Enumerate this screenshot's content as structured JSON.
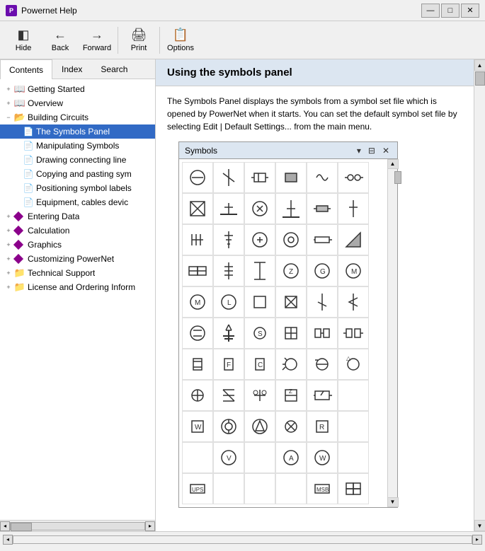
{
  "app": {
    "title": "Powernet Help",
    "icon": "P"
  },
  "title_controls": {
    "minimize": "—",
    "maximize": "□",
    "close": "✕"
  },
  "toolbar": {
    "buttons": [
      {
        "id": "hide",
        "label": "Hide",
        "icon": "◧"
      },
      {
        "id": "back",
        "label": "Back",
        "icon": "←"
      },
      {
        "id": "forward",
        "label": "Forward",
        "icon": "→"
      },
      {
        "id": "print",
        "label": "Print",
        "icon": "🖨"
      },
      {
        "id": "options",
        "label": "Options",
        "icon": "📋"
      }
    ]
  },
  "left_panel": {
    "tabs": [
      "Contents",
      "Index",
      "Search"
    ],
    "active_tab": "Contents",
    "tree": [
      {
        "id": "getting-started",
        "label": "Getting Started",
        "level": 0,
        "type": "book",
        "expanded": false
      },
      {
        "id": "overview",
        "label": "Overview",
        "level": 0,
        "type": "book",
        "expanded": false
      },
      {
        "id": "building-circuits",
        "label": "Building Circuits",
        "level": 0,
        "type": "book",
        "expanded": true
      },
      {
        "id": "symbols-panel",
        "label": "The Symbols Panel",
        "level": 1,
        "type": "page",
        "selected": true
      },
      {
        "id": "manipulating",
        "label": "Manipulating Symbols",
        "level": 1,
        "type": "page"
      },
      {
        "id": "drawing-connecting",
        "label": "Drawing connecting line",
        "level": 1,
        "type": "page"
      },
      {
        "id": "copying-pasting",
        "label": "Copying and pasting sym",
        "level": 1,
        "type": "page"
      },
      {
        "id": "positioning",
        "label": "Positioning symbol labels",
        "level": 1,
        "type": "page"
      },
      {
        "id": "equipment",
        "label": "Equipment, cables devic",
        "level": 1,
        "type": "page"
      },
      {
        "id": "entering-data",
        "label": "Entering Data",
        "level": 0,
        "type": "diamond"
      },
      {
        "id": "calculation",
        "label": "Calculation",
        "level": 0,
        "type": "diamond"
      },
      {
        "id": "graphics",
        "label": "Graphics",
        "level": 0,
        "type": "diamond"
      },
      {
        "id": "customizing",
        "label": "Customizing PowerNet",
        "level": 0,
        "type": "diamond"
      },
      {
        "id": "technical-support",
        "label": "Technical Support",
        "level": 0,
        "type": "folder"
      },
      {
        "id": "license",
        "label": "License and Ordering Inform",
        "level": 0,
        "type": "folder"
      }
    ]
  },
  "content": {
    "title": "Using the symbols panel",
    "body": "The Symbols Panel displays the symbols from a symbol set file which is opened by PowerNet when it starts.  You can set the default symbol set file by selecting Edit | Default Settings... from the main menu."
  },
  "symbols_panel": {
    "title": "Symbols",
    "controls": [
      "▾",
      "⊟",
      "✕"
    ],
    "symbols": [
      "⊗",
      "⟨⟩",
      "⊕",
      "▭",
      "~",
      "⊏",
      "⊠",
      "⊥",
      "⊙",
      "⊤",
      "▭",
      "┤",
      "✳",
      "┤",
      "⊕",
      "⊙",
      "▭",
      "◿",
      "⊞",
      "≡",
      "⊣",
      "Z",
      "G",
      "M",
      "M",
      "L",
      "□",
      "⊠",
      "⟂",
      "⟵",
      "⊕",
      "⚡",
      "S",
      "⊞",
      "⊟",
      "⊠",
      "⊟",
      "F",
      "C",
      "⊕",
      "⊕",
      "⊕",
      "⊕",
      "✳",
      "⊕",
      "⊞",
      "Z",
      "▭",
      "W",
      "⊕",
      "△",
      "⊕",
      "R",
      "",
      "",
      "V",
      "",
      "A",
      "W",
      "",
      "UPS",
      "",
      "",
      "",
      "MSB",
      "⊞"
    ]
  }
}
